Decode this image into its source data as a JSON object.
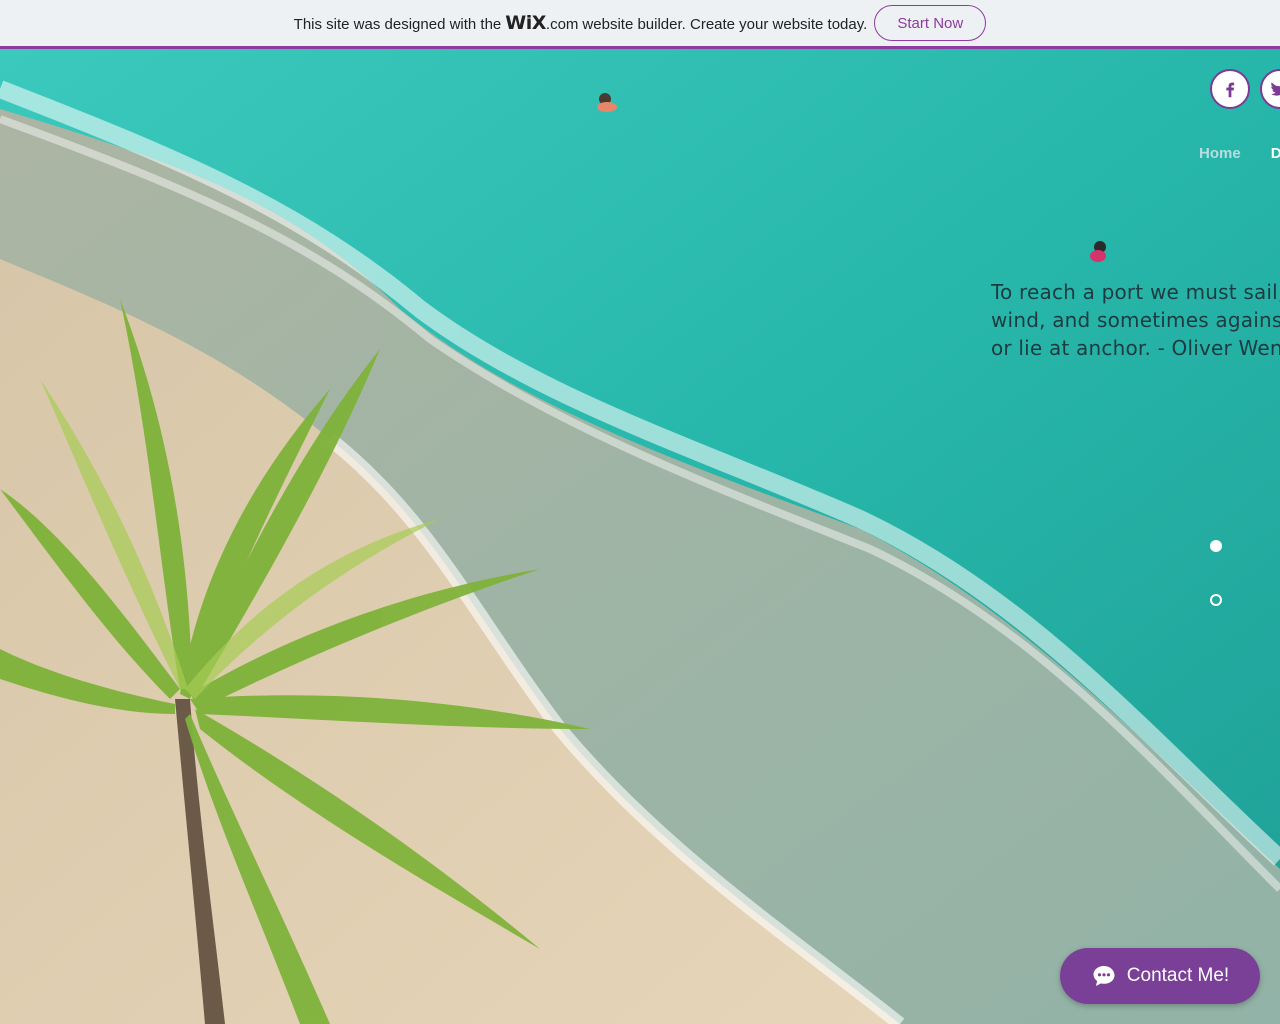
{
  "banner": {
    "text_before": "This site was designed with the",
    "logo": "WiX",
    "logo_suffix": ".com",
    "text_after": "website builder. Create your website today.",
    "cta_label": "Start Now",
    "accent_color": "#8e3aa2"
  },
  "social": {
    "items": [
      {
        "name": "facebook",
        "icon": "facebook-icon"
      },
      {
        "name": "twitter",
        "icon": "twitter-icon"
      }
    ]
  },
  "nav": {
    "items": [
      {
        "label": "Home"
      },
      {
        "label": "D"
      }
    ]
  },
  "hero": {
    "quote_line1": "To reach a port we must sail, so",
    "quote_line2": "wind, and sometimes against it",
    "quote_line3": "or lie at anchor. - Oliver Wende"
  },
  "anchors": {
    "active_index": 0,
    "count": 2
  },
  "chat": {
    "label": "Contact Me!",
    "icon": "chat-bubble-icon",
    "color": "#7a3f96"
  }
}
